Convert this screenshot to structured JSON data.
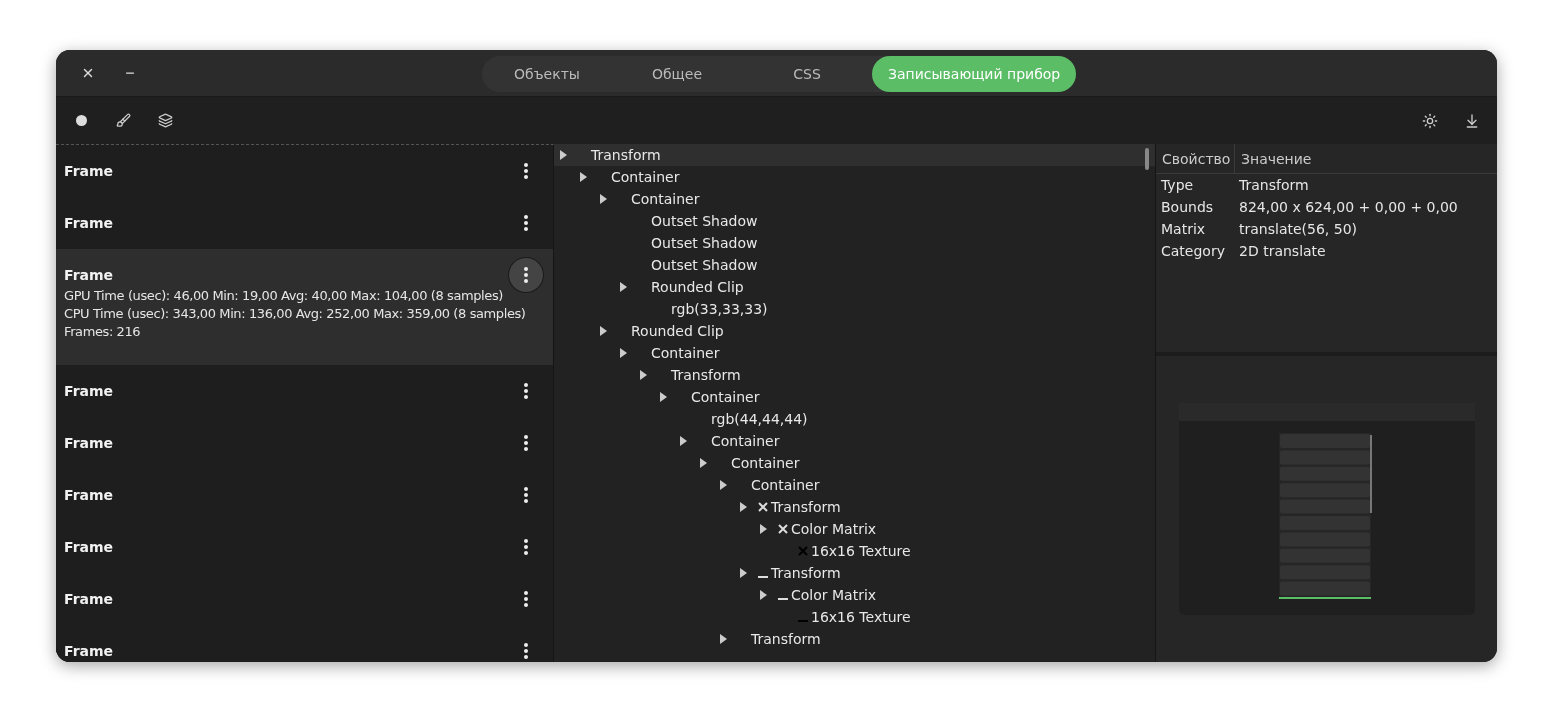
{
  "tabs": [
    {
      "label": "Объекты",
      "selected": false
    },
    {
      "label": "Общее",
      "selected": false
    },
    {
      "label": "CSS",
      "selected": false
    },
    {
      "label": "Записывающий прибор",
      "selected": true
    }
  ],
  "frames": [
    {
      "title": "Frame",
      "selected": false
    },
    {
      "title": "Frame",
      "selected": false
    },
    {
      "title": "Frame",
      "selected": true,
      "details": [
        "GPU Time (usec): 46,00 Min: 19,00 Avg: 40,00 Max: 104,00 (8 samples)",
        "CPU Time (usec): 343,00 Min: 136,00 Avg: 252,00 Max: 359,00 (8 samples)",
        "Frames: 216"
      ]
    },
    {
      "title": "Frame",
      "selected": false
    },
    {
      "title": "Frame",
      "selected": false
    },
    {
      "title": "Frame",
      "selected": false
    },
    {
      "title": "Frame",
      "selected": false
    },
    {
      "title": "Frame",
      "selected": false
    },
    {
      "title": "Frame",
      "selected": false
    }
  ],
  "render_tree": [
    {
      "label": "Transform",
      "selected": true,
      "expandable": true,
      "children": [
        {
          "label": "Container",
          "selected": false,
          "expandable": true,
          "children": [
            {
              "label": "Container",
              "selected": false,
              "expandable": true,
              "children": [
                {
                  "label": "Outset Shadow",
                  "selected": false,
                  "expandable": false
                },
                {
                  "label": "Outset Shadow",
                  "selected": false,
                  "expandable": false
                },
                {
                  "label": "Outset Shadow",
                  "selected": false,
                  "expandable": false
                },
                {
                  "label": "Rounded Clip",
                  "selected": false,
                  "expandable": true,
                  "children": [
                    {
                      "label": "rgb(33,33,33)",
                      "selected": false,
                      "expandable": false
                    }
                  ]
                }
              ]
            },
            {
              "label": "Rounded Clip",
              "selected": false,
              "expandable": true,
              "children": [
                {
                  "label": "Container",
                  "selected": false,
                  "expandable": true,
                  "children": [
                    {
                      "label": "Transform",
                      "selected": false,
                      "expandable": true,
                      "children": [
                        {
                          "label": "Container",
                          "selected": false,
                          "expandable": true,
                          "children": [
                            {
                              "label": "rgb(44,44,44)",
                              "selected": false,
                              "expandable": false
                            },
                            {
                              "label": "Container",
                              "selected": false,
                              "expandable": true,
                              "children": [
                                {
                                  "label": "Container",
                                  "selected": false,
                                  "expandable": true,
                                  "children": [
                                    {
                                      "label": "Container",
                                      "selected": false,
                                      "expandable": true,
                                      "children": [
                                        {
                                          "label": "Transform",
                                          "selected": false,
                                          "expandable": true,
                                          "kind": "cross",
                                          "children": [
                                            {
                                              "label": "Color Matrix",
                                              "selected": false,
                                              "expandable": true,
                                              "kind": "cross",
                                              "children": [
                                                {
                                                  "label": "16x16 Texture",
                                                  "selected": false,
                                                  "expandable": false,
                                                  "kind": "cross-dark"
                                                }
                                              ]
                                            }
                                          ]
                                        },
                                        {
                                          "label": "Transform",
                                          "selected": false,
                                          "expandable": true,
                                          "kind": "dash",
                                          "children": [
                                            {
                                              "label": "Color Matrix",
                                              "selected": false,
                                              "expandable": true,
                                              "kind": "dash",
                                              "children": [
                                                {
                                                  "label": "16x16 Texture",
                                                  "selected": false,
                                                  "expandable": false,
                                                  "kind": "dash-dark"
                                                }
                                              ]
                                            }
                                          ]
                                        }
                                      ]
                                    },
                                    {
                                      "label": "Transform",
                                      "selected": false,
                                      "expandable": true
                                    }
                                  ]
                                }
                              ]
                            }
                          ]
                        }
                      ]
                    }
                  ]
                }
              ]
            }
          ]
        }
      ]
    }
  ],
  "properties": {
    "columns": [
      "Свойство",
      "Значение"
    ],
    "rows": [
      [
        "Type",
        "Transform"
      ],
      [
        "Bounds",
        "824,00 x 624,00 + 0,00 + 0,00"
      ],
      [
        "Matrix",
        "translate(56, 50)"
      ],
      [
        "Category",
        "2D translate"
      ]
    ]
  }
}
